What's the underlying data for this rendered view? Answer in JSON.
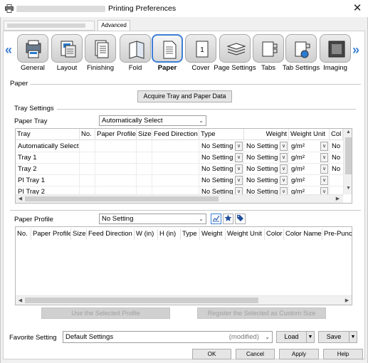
{
  "window": {
    "title": "Printing Preferences",
    "close_glyph": "✕"
  },
  "tabs_top": {
    "advanced": "Advanced"
  },
  "nav": {
    "left": "«",
    "right": "»"
  },
  "tabs": [
    {
      "label": "General",
      "icon": "general-icon"
    },
    {
      "label": "Layout",
      "icon": "layout-icon"
    },
    {
      "label": "Finishing",
      "icon": "finishing-icon"
    },
    {
      "label": "Fold",
      "icon": "fold-icon"
    },
    {
      "label": "Paper",
      "icon": "paper-icon",
      "selected": true
    },
    {
      "label": "Cover",
      "icon": "cover-icon"
    },
    {
      "label": "Page Settings",
      "icon": "page-settings-icon"
    },
    {
      "label": "Tabs",
      "icon": "tabs-icon"
    },
    {
      "label": "Tab Settings",
      "icon": "tab-settings-icon"
    },
    {
      "label": "Imaging",
      "icon": "imaging-icon"
    }
  ],
  "paper": {
    "section_label": "Paper",
    "acquire_button": "Acquire Tray and Paper Data",
    "tray_settings_label": "Tray Settings",
    "paper_tray_label": "Paper Tray",
    "paper_tray_value": "Automatically Select",
    "tray_table": {
      "columns": [
        "Tray",
        "No.",
        "Paper Profile",
        "Size",
        "Feed Direction",
        "Type",
        "Weight",
        "Weight Unit",
        "Col"
      ],
      "rows": [
        {
          "tray": "Automatically Select",
          "type": "No Setting",
          "weight": "No Setting",
          "unit": "g/m²",
          "col": "No"
        },
        {
          "tray": "Tray 1",
          "type": "No Setting",
          "weight": "No Setting",
          "unit": "g/m²",
          "col": "No"
        },
        {
          "tray": "Tray 2",
          "type": "No Setting",
          "weight": "No Setting",
          "unit": "g/m²",
          "col": "No"
        },
        {
          "tray": "PI Tray 1",
          "type": "No Setting",
          "weight": "No Setting",
          "unit": "g/m²",
          "col": ""
        },
        {
          "tray": "PI Tray 2",
          "type": "No Setting",
          "weight": "No Setting",
          "unit": "g/m²",
          "col": ""
        }
      ]
    },
    "paper_profile_label": "Paper Profile",
    "paper_profile_value": "No Setting",
    "profile_table": {
      "columns": [
        "No.",
        "Paper Profile",
        "Size",
        "Feed Direction",
        "W (in)",
        "H (in)",
        "Type",
        "Weight",
        "Weight Unit",
        "Color",
        "Color Name",
        "Pre-Punch"
      ]
    },
    "use_selected_button": "Use the Selected Profile",
    "register_button": "Register the Selected as Custom Size"
  },
  "favorite": {
    "label": "Favorite Setting",
    "value": "Default Settings",
    "status": "(modified)",
    "load_button": "Load",
    "save_button": "Save"
  },
  "footer": {
    "ok": "OK",
    "cancel": "Cancel",
    "apply": "Apply",
    "help": "Help"
  },
  "colors": {
    "accent": "#3d7ed6",
    "arrow": "#3a7fd5"
  }
}
